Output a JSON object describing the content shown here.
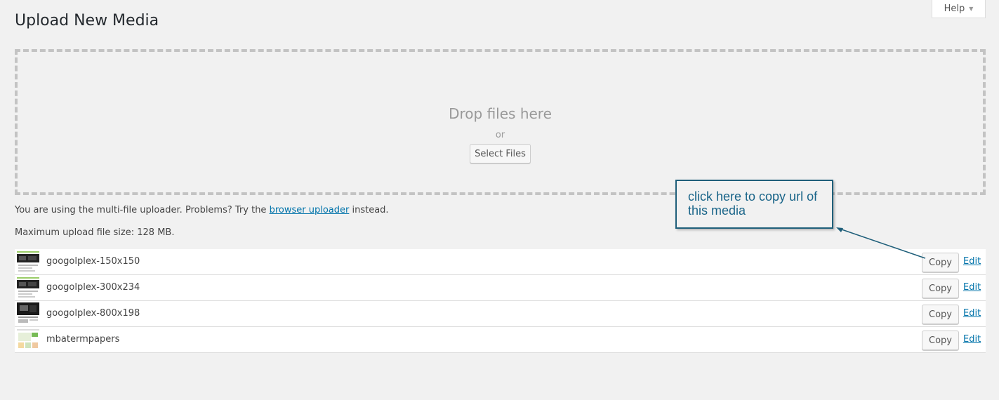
{
  "page": {
    "title": "Upload New Media"
  },
  "help": {
    "label": "Help"
  },
  "uploader": {
    "drop_title": "Drop files here",
    "or_text": "or",
    "select_button": "Select Files",
    "info_prefix": "You are using the multi-file uploader. Problems? Try the ",
    "info_link": "browser uploader",
    "info_suffix": " instead.",
    "max_size": "Maximum upload file size: 128 MB."
  },
  "media": [
    {
      "name": "googolplex-150x150",
      "copy_label": "Copy",
      "edit_label": "Edit",
      "thumb": "dark-screenshot"
    },
    {
      "name": "googolplex-300x234",
      "copy_label": "Copy",
      "edit_label": "Edit",
      "thumb": "dark-screenshot"
    },
    {
      "name": "googolplex-800x198",
      "copy_label": "Copy",
      "edit_label": "Edit",
      "thumb": "dark-banner"
    },
    {
      "name": "mbatermpapers",
      "copy_label": "Copy",
      "edit_label": "Edit",
      "thumb": "light-page"
    }
  ],
  "annotation": {
    "text": "click here to copy url of this media",
    "color": "#1a6589"
  },
  "colors": {
    "link": "#0073aa",
    "background": "#f1f1f1"
  }
}
